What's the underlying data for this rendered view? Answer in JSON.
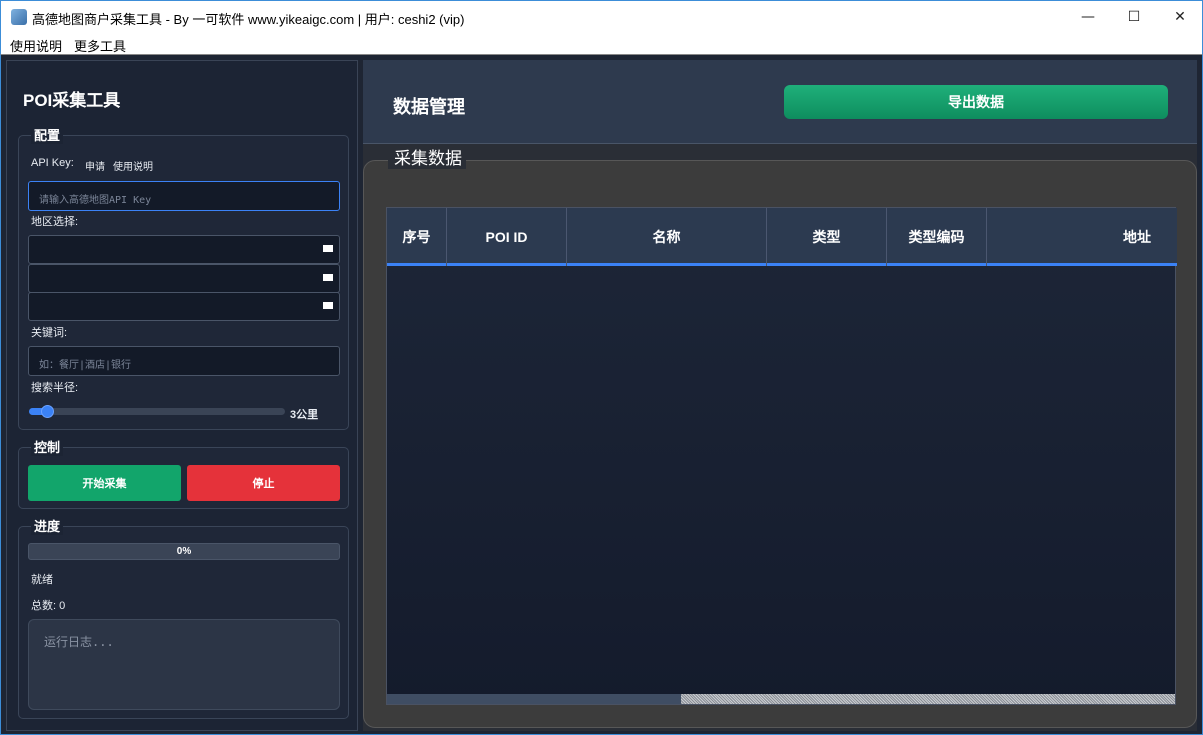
{
  "window": {
    "title": "高德地图商户采集工具 - By 一可软件 www.yikeaigc.com | 用户: ceshi2 (vip)",
    "minimize": "—",
    "maximize": "☐",
    "close": "✕"
  },
  "menu": [
    "使用说明",
    "更多工具"
  ],
  "sidebar": {
    "app_title": "POI采集工具",
    "config": {
      "title": "配置",
      "api_key_label": "API Key:",
      "apply_link": "申请",
      "help_link": "使用说明",
      "api_placeholder": "请输入高德地图API Key",
      "region_label": "地区选择:",
      "keyword_label": "关键词:",
      "keyword_placeholder": "如：餐厅|酒店|银行",
      "radius_label": "搜索半径:",
      "radius_value": "3公里",
      "radius_level": 0.07
    },
    "control": {
      "title": "控制",
      "start": "开始采集",
      "stop": "停止",
      "start_color": "#12a56b",
      "stop_color": "#e5323a"
    },
    "progress": {
      "title": "进度",
      "percent_text": "0%",
      "status": "就绪",
      "total": "总数: 0",
      "log_placeholder": "运行日志..."
    }
  },
  "main": {
    "heading": "数据管理",
    "export_button": "导出数据",
    "section_title": "采集数据",
    "columns": [
      "序号",
      "POI ID",
      "名称",
      "类型",
      "类型编码",
      "地址"
    ]
  }
}
